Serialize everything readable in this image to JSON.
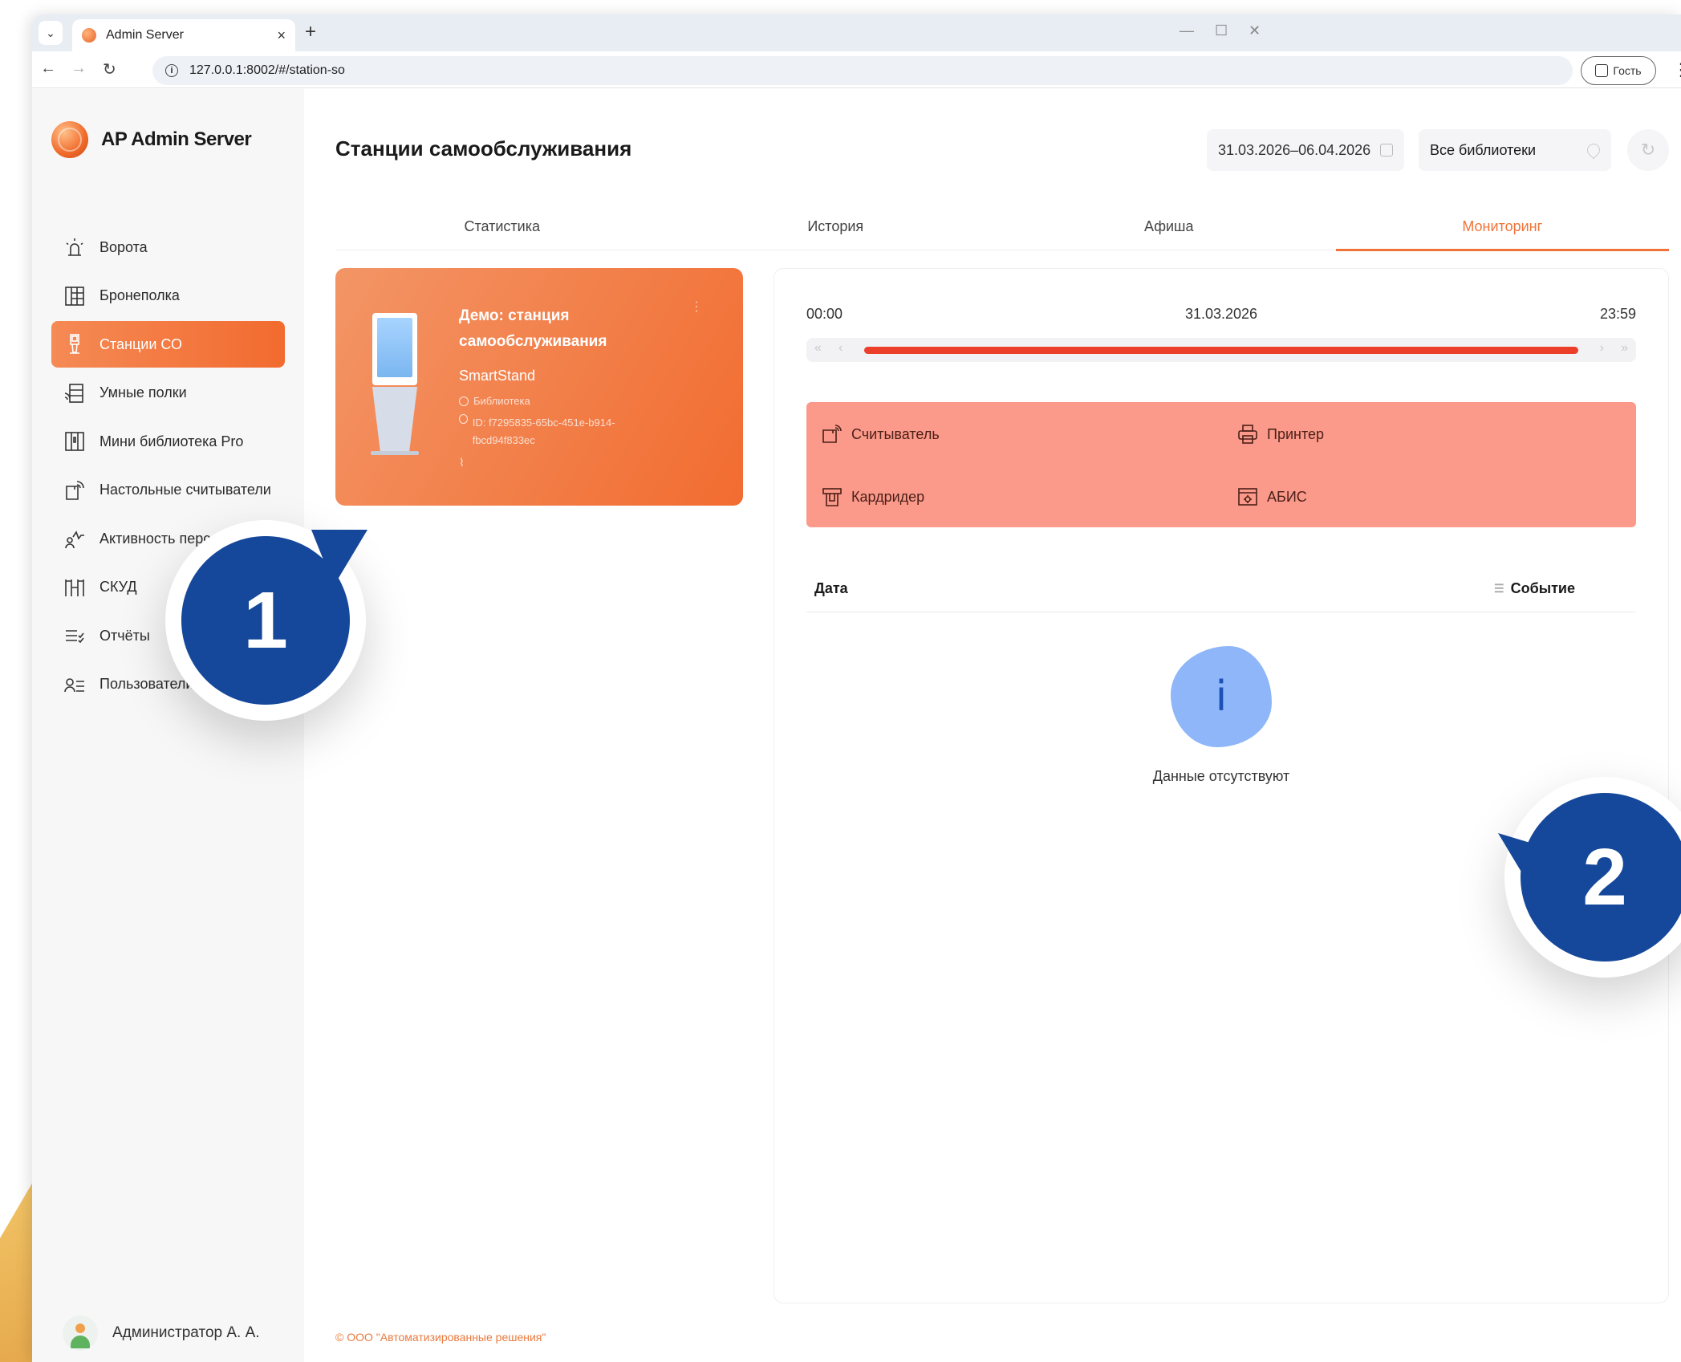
{
  "browser": {
    "tab_title": "Admin Server",
    "url": "127.0.0.1:8002/#/station-so",
    "guest_label": "Гость"
  },
  "brand": {
    "name": "AP Admin Server"
  },
  "sidebar": {
    "items": [
      {
        "label": "Ворота",
        "icon": "gate-light-icon"
      },
      {
        "label": "Бронеполка",
        "icon": "locker-grid-icon"
      },
      {
        "label": "Станции СО",
        "icon": "kiosk-icon",
        "active": true
      },
      {
        "label": "Умные полки",
        "icon": "smart-shelf-icon"
      },
      {
        "label": "Мини библиотека Pro",
        "icon": "mini-library-icon"
      },
      {
        "label": "Настольные считыватели",
        "icon": "desktop-reader-icon"
      },
      {
        "label": "Активность персонала",
        "icon": "staff-activity-icon"
      },
      {
        "label": "СКУД",
        "icon": "turnstile-icon"
      },
      {
        "label": "Отчёты",
        "icon": "reports-icon"
      },
      {
        "label": "Пользователи",
        "icon": "users-icon"
      }
    ],
    "user_name": "Администратор А. А."
  },
  "header": {
    "title": "Станции самообслуживания",
    "date_range": "31.03.2026–06.04.2026",
    "library_select": "Все библиотеки"
  },
  "tabs": [
    {
      "label": "Статистика"
    },
    {
      "label": "История"
    },
    {
      "label": "Афиша"
    },
    {
      "label": "Мониторинг",
      "active": true
    }
  ],
  "station": {
    "name": "Демо: станция самообслуживания",
    "model": "SmartStand",
    "library": "Библиотека",
    "id": "ID: f7295835-65bc-451e-b914-fbcd94f833ec"
  },
  "timeline": {
    "start": "00:00",
    "date": "31.03.2026",
    "end": "23:59"
  },
  "devices": [
    {
      "label": "Считыватель",
      "icon": "reader-icon"
    },
    {
      "label": "Принтер",
      "icon": "printer-icon"
    },
    {
      "label": "Кардридер",
      "icon": "cardreader-icon"
    },
    {
      "label": "АБИС",
      "icon": "abis-icon"
    }
  ],
  "events_table": {
    "col_date": "Дата",
    "col_event": "Событие",
    "empty_text": "Данные отсутствуют",
    "empty_icon_glyph": "i"
  },
  "footer": {
    "copyright": "© ООО \"Автоматизированные решения\""
  },
  "callouts": {
    "one": "1",
    "two": "2"
  },
  "colors": {
    "accent": "#f0743a",
    "active_gradient_start": "#f58a55",
    "active_gradient_end": "#f26b2f",
    "device_error_bg": "#fb9a8a",
    "timeline_bar": "#ec3f2a",
    "callout_blue": "#15479a"
  }
}
